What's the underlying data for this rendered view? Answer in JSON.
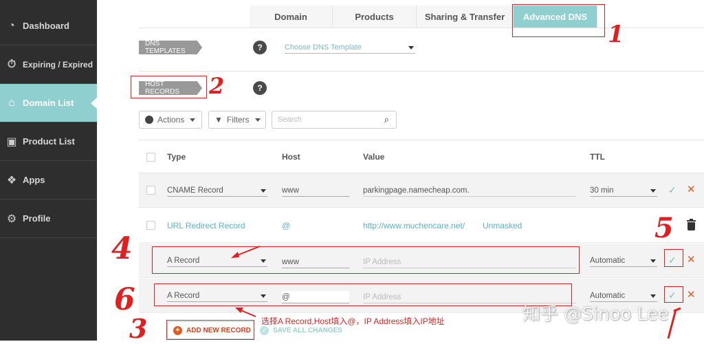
{
  "sidebar": {
    "items": [
      {
        "label": "Dashboard",
        "icon": "gauge-icon"
      },
      {
        "label": "Expiring / Expired",
        "icon": "stopwatch-icon"
      },
      {
        "label": "Domain List",
        "icon": "home-icon"
      },
      {
        "label": "Product List",
        "icon": "box-icon"
      },
      {
        "label": "Apps",
        "icon": "apps-icon"
      },
      {
        "label": "Profile",
        "icon": "gear-icon"
      }
    ]
  },
  "tabs": [
    {
      "label": "Domain"
    },
    {
      "label": "Products"
    },
    {
      "label": "Sharing & Transfer"
    },
    {
      "label": "Advanced DNS"
    }
  ],
  "dns_templates": {
    "label": "DNS TEMPLATES",
    "help": "?",
    "select_value": "Choose DNS Template"
  },
  "host_records": {
    "label": "HOST RECORDS",
    "help": "?"
  },
  "toolbar": {
    "actions_label": "Actions",
    "filters_label": "Filters",
    "search_placeholder": "Search"
  },
  "table": {
    "headers": {
      "type": "Type",
      "host": "Host",
      "value": "Value",
      "ttl": "TTL"
    },
    "rows": [
      {
        "type": "CNAME Record",
        "host": "www",
        "value": "parkingpage.namecheap.com.",
        "ttl": "30 min"
      },
      {
        "type": "URL Redirect Record",
        "host": "@",
        "value": "http://www.muchencare.net/",
        "extra": "Unmasked"
      },
      {
        "type": "A Record",
        "host": "www",
        "value_placeholder": "IP Address",
        "ttl": "Automatic"
      },
      {
        "type": "A Record",
        "host": "@",
        "value_placeholder": "IP Address",
        "ttl": "Automatic"
      }
    ]
  },
  "footer": {
    "add_label": "ADD NEW RECORD",
    "save_label": "SAVE ALL CHANGES"
  },
  "annotations": {
    "n1": "1",
    "n2": "2",
    "n3": "3",
    "n4": "4",
    "n5": "5",
    "n6": "6",
    "note": "选择A Record,Host填入@，IP Address填入IP地址",
    "watermark": "知乎 @Sinoo Lee"
  },
  "colors": {
    "accent": "#8fcfcf",
    "danger": "#e05a1e",
    "annotation": "#e02020"
  }
}
